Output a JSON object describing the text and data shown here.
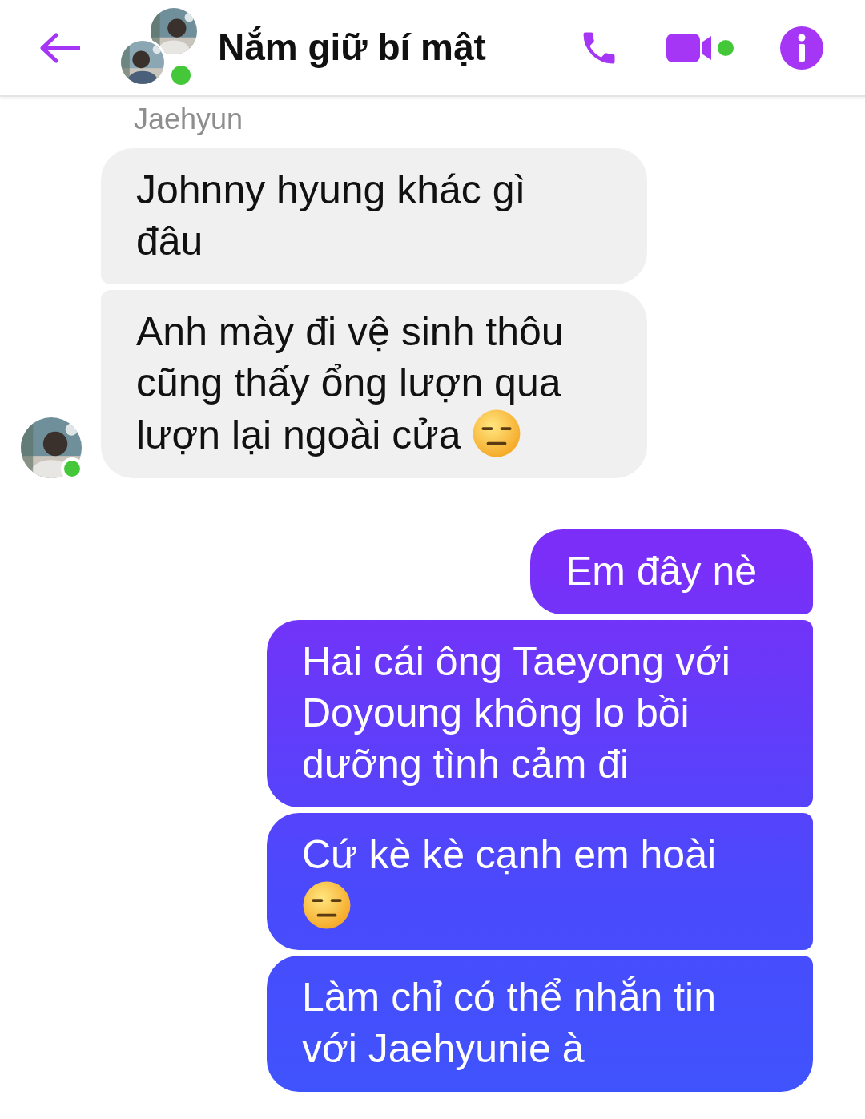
{
  "header": {
    "title": "Nắm giữ bí mật",
    "online": true,
    "video_dot": true
  },
  "groups": [
    {
      "kind": "incoming",
      "sender": "Jaehyun",
      "avatar_online": true,
      "messages": [
        {
          "kind": "text",
          "text": "Johnny hyung khác gì đâu"
        },
        {
          "kind": "text_with_expressionless_emoji",
          "text": "Anh mày đi vệ sinh thôu cũng thấy ổng lượn qua lượn lại ngoài cửa"
        }
      ]
    },
    {
      "kind": "outgoing",
      "messages": [
        {
          "kind": "text",
          "text": "Em đây nè"
        },
        {
          "kind": "text",
          "text": "Hai cái ông Taeyong với Doyoung không lo bồi dưỡng tình cảm đi"
        },
        {
          "kind": "text_with_expressionless_emoji",
          "text": "Cứ kè kè cạnh em hoài"
        },
        {
          "kind": "text",
          "text": "Làm chỉ có thể nhắn tin với Jaehyunie à"
        }
      ]
    }
  ]
}
